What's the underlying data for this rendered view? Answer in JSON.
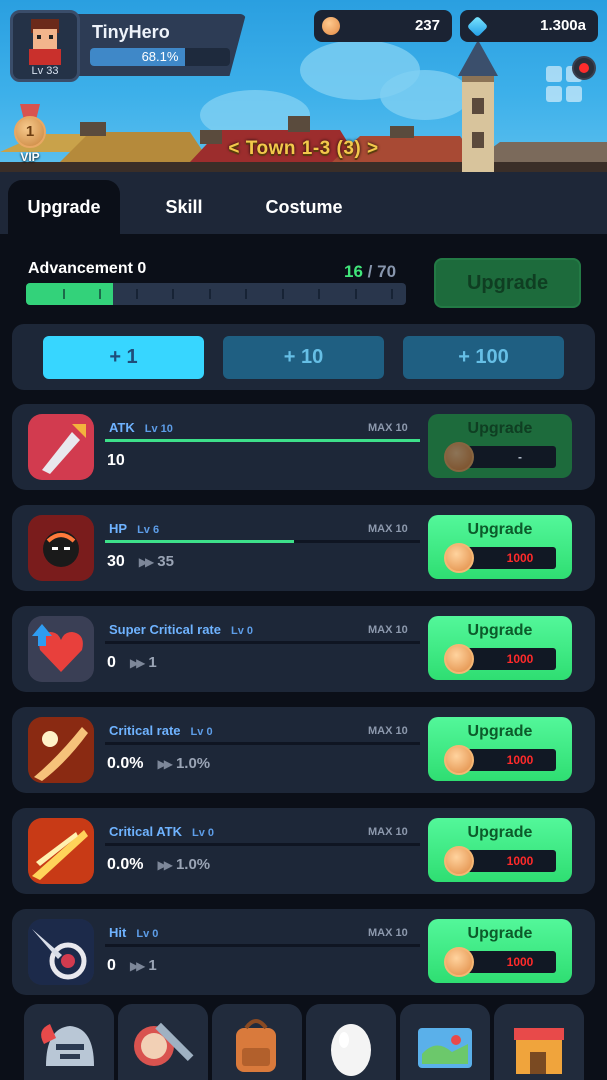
{
  "player": {
    "name": "TinyHero",
    "level": "Lv 33",
    "exp_percent": "68.1%",
    "exp_fraction": 0.681
  },
  "currencies": {
    "coins": "237",
    "gems": "1.300a"
  },
  "vip": {
    "label": "VIP",
    "level": "1"
  },
  "stage": {
    "title": "< Town 1-3 (3) >"
  },
  "tabs": [
    {
      "label": "Upgrade"
    },
    {
      "label": "Skill"
    },
    {
      "label": "Costume"
    }
  ],
  "advancement": {
    "title": "Advancement 0",
    "current": "16",
    "separator": "/",
    "max": "70",
    "progress": 0.229,
    "button": "Upgrade"
  },
  "quantity": [
    {
      "label": "+ 1"
    },
    {
      "label": "+ 10"
    },
    {
      "label": "+ 100"
    }
  ],
  "stats": [
    {
      "name": "ATK",
      "level": "Lv 10",
      "max": "MAX 10",
      "value": "10",
      "next": "",
      "progress": 1.0,
      "button": "Upgrade",
      "cost": "-",
      "enabled": false,
      "icon": "sword-icon"
    },
    {
      "name": "HP",
      "level": "Lv 6",
      "max": "MAX 10",
      "value": "30",
      "next": "35",
      "progress": 0.6,
      "button": "Upgrade",
      "cost": "1000",
      "enabled": true,
      "icon": "hp-icon"
    },
    {
      "name": "Super Critical rate",
      "level": "Lv 0",
      "max": "MAX 10",
      "value": "0",
      "next": "1",
      "progress": 0.0,
      "button": "Upgrade",
      "cost": "1000",
      "enabled": true,
      "icon": "heart-icon"
    },
    {
      "name": "Critical rate",
      "level": "Lv 0",
      "max": "MAX 10",
      "value": "0.0%",
      "next": "1.0%",
      "progress": 0.0,
      "button": "Upgrade",
      "cost": "1000",
      "enabled": true,
      "icon": "critical-rate-icon"
    },
    {
      "name": "Critical ATK",
      "level": "Lv 0",
      "max": "MAX 10",
      "value": "0.0%",
      "next": "1.0%",
      "progress": 0.0,
      "button": "Upgrade",
      "cost": "1000",
      "enabled": true,
      "icon": "critical-atk-icon"
    },
    {
      "name": "Hit",
      "level": "Lv 0",
      "max": "MAX 10",
      "value": "0",
      "next": "1",
      "progress": 0.0,
      "button": "Upgrade",
      "cost": "1000",
      "enabled": true,
      "icon": "hit-icon"
    }
  ],
  "bottom_nav": [
    {
      "name": "helmet-icon",
      "active": true
    },
    {
      "name": "weapon-icon",
      "active": false
    },
    {
      "name": "backpack-icon",
      "active": false
    },
    {
      "name": "egg-icon",
      "active": false
    },
    {
      "name": "map-icon",
      "active": false
    },
    {
      "name": "shop-icon",
      "active": false
    }
  ],
  "colors": {
    "accent_green": "#33d27a",
    "accent_blue": "#37d6ff",
    "cost_red": "#ff2a2a",
    "stage_gold": "#f3c84b"
  }
}
